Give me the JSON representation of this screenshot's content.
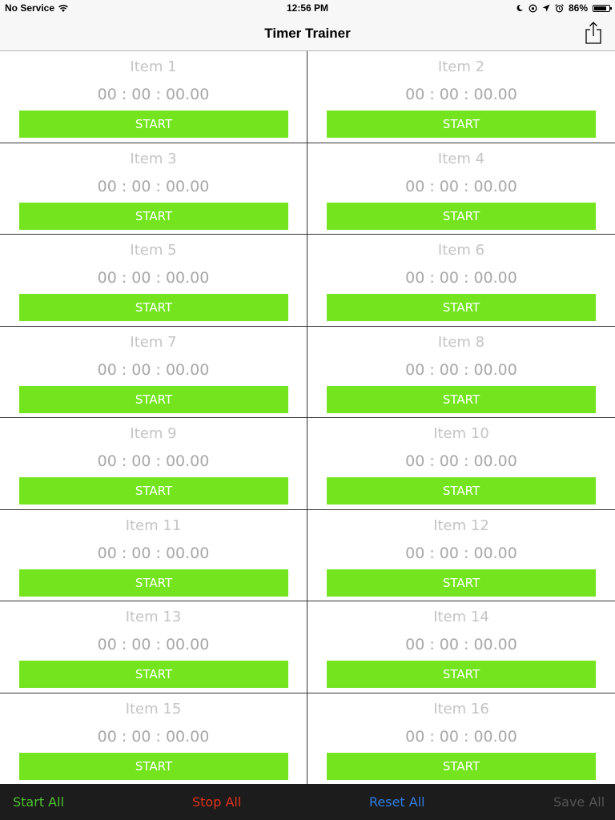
{
  "status_bar": {
    "carrier": "No Service",
    "time": "12:56 PM",
    "battery_percent": "86%",
    "battery_level": 0.86
  },
  "nav": {
    "title": "Timer Trainer"
  },
  "timers": [
    {
      "label": "Item 1",
      "time": "00 : 00 : 00.00",
      "button": "START"
    },
    {
      "label": "Item 2",
      "time": "00 : 00 : 00.00",
      "button": "START"
    },
    {
      "label": "Item 3",
      "time": "00 : 00 : 00.00",
      "button": "START"
    },
    {
      "label": "Item 4",
      "time": "00 : 00 : 00.00",
      "button": "START"
    },
    {
      "label": "Item 5",
      "time": "00 : 00 : 00.00",
      "button": "START"
    },
    {
      "label": "Item 6",
      "time": "00 : 00 : 00.00",
      "button": "START"
    },
    {
      "label": "Item 7",
      "time": "00 : 00 : 00.00",
      "button": "START"
    },
    {
      "label": "Item 8",
      "time": "00 : 00 : 00.00",
      "button": "START"
    },
    {
      "label": "Item 9",
      "time": "00 : 00 : 00.00",
      "button": "START"
    },
    {
      "label": "Item 10",
      "time": "00 : 00 : 00.00",
      "button": "START"
    },
    {
      "label": "Item 11",
      "time": "00 : 00 : 00.00",
      "button": "START"
    },
    {
      "label": "Item 12",
      "time": "00 : 00 : 00.00",
      "button": "START"
    },
    {
      "label": "Item 13",
      "time": "00 : 00 : 00.00",
      "button": "START"
    },
    {
      "label": "Item 14",
      "time": "00 : 00 : 00.00",
      "button": "START"
    },
    {
      "label": "Item 15",
      "time": "00 : 00 : 00.00",
      "button": "START"
    },
    {
      "label": "Item 16",
      "time": "00 : 00 : 00.00",
      "button": "START"
    }
  ],
  "toolbar": {
    "start_all": "Start All",
    "stop_all": "Stop All",
    "reset_all": "Reset All",
    "save_all": "Save All"
  },
  "colors": {
    "start_green": "#74e41f",
    "start_all": "#4cc32d",
    "stop_all": "#e0321b",
    "reset_all": "#2f7de1",
    "save_all_disabled": "#555555"
  }
}
